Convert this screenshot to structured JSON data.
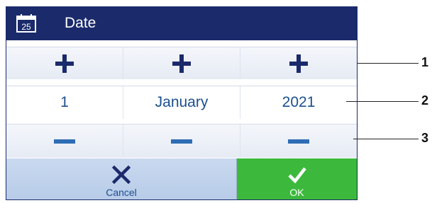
{
  "header": {
    "title": "Date",
    "icon": "calendar-icon",
    "calendar_day": "25"
  },
  "date": {
    "day": "1",
    "month": "January",
    "year": "2021"
  },
  "footer": {
    "cancel_label": "Cancel",
    "ok_label": "OK"
  },
  "callouts": [
    "1",
    "2",
    "3"
  ],
  "colors": {
    "header_bg": "#1b2a6b",
    "accent": "#1c4f8f",
    "ok_bg": "#3cb93c",
    "cancel_bg": "#c9d9ef",
    "minus": "#2f6db5"
  }
}
